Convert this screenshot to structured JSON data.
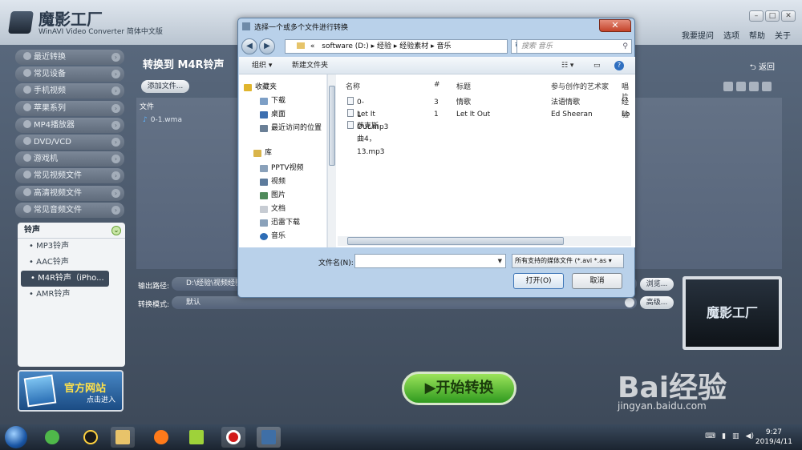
{
  "app": {
    "name": "魔影工厂",
    "subtitle": "WinAVI Video Converter 简体中文版",
    "menu": [
      "我要提问",
      "选项",
      "帮助",
      "关于"
    ]
  },
  "sidebar": {
    "items": [
      "最近转换",
      "常见设备",
      "手机视频",
      "苹果系列",
      "MP4播放器",
      "DVD/VCD",
      "游戏机",
      "常见视频文件",
      "高清视频文件",
      "常见音频文件"
    ],
    "ringtone": {
      "header": "铃声",
      "subs": [
        "MP3铃声",
        "AAC铃声",
        "M4R铃声（iPho...",
        "AMR铃声"
      ],
      "selected_index": 2
    },
    "promo": {
      "line1": "官方网站",
      "line2": "点击进入"
    }
  },
  "main": {
    "title": "转换到 M4R铃声",
    "back": "返回",
    "add_file": "添加文件...",
    "file_header": "文件",
    "files": [
      "0-1.wma"
    ],
    "output_label": "输出路径:",
    "output_value": "D:\\经验\\视频经验\\",
    "mode_label": "转换模式:",
    "mode_value": "默认",
    "browse": "浏览...",
    "advanced": "高级...",
    "preview_text": "魔影工厂",
    "start": "开始转换"
  },
  "dialog": {
    "title": "选择一个或多个文件进行转换",
    "address": [
      "«",
      "software (D:)",
      "经验",
      "经验素材",
      "音乐"
    ],
    "search_placeholder": "搜索 音乐",
    "toolbar": {
      "organize": "组织 ▾",
      "new_folder": "新建文件夹"
    },
    "nav": {
      "favorites": "收藏夹",
      "fav_items": [
        "下载",
        "桌面",
        "最近访问的位置"
      ],
      "library": "库",
      "lib_items": [
        "PPTV视频",
        "视频",
        "图片",
        "文档",
        "迅雷下载",
        "音乐"
      ]
    },
    "columns": [
      "名称",
      "#",
      "标题",
      "参与创作的艺术家",
      "唱片"
    ],
    "rows": [
      {
        "name": "0-1",
        "num": "3",
        "title": "情歌",
        "artist": "法语情歌",
        "album": "经验"
      },
      {
        "name": "Let It Out.mp3",
        "num": "1",
        "title": "Let It Out",
        "artist": "Ed Sheeran",
        "album": "Lo"
      },
      {
        "name": "萨克斯曲4，13.mp3",
        "num": "",
        "title": "",
        "artist": "",
        "album": ""
      }
    ],
    "filename_label": "文件名(N):",
    "filename_value": "",
    "filetype": "所有支持的媒体文件 (*.avi *.as",
    "open": "打开(O)",
    "cancel": "取消"
  },
  "taskbar": {
    "time": "9:27",
    "date": "2019/4/11"
  },
  "watermark": {
    "brand": "Bai经验",
    "url": "jingyan.baidu.com"
  }
}
